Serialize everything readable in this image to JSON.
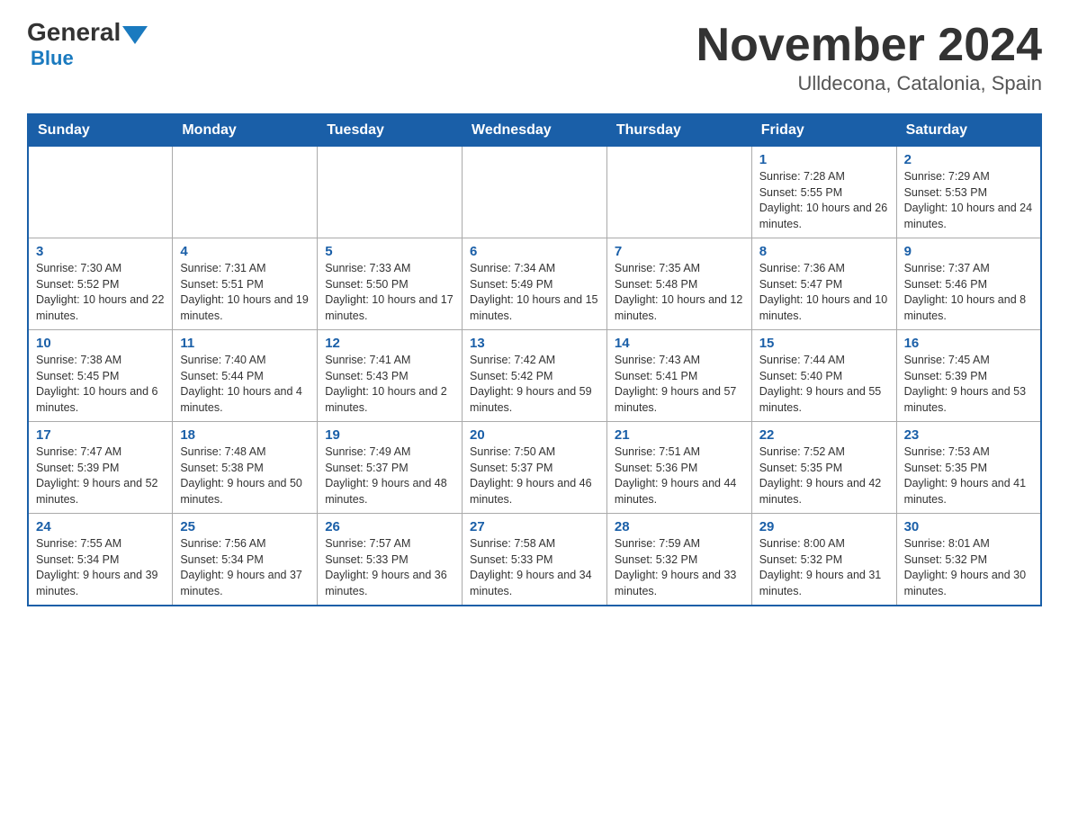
{
  "header": {
    "logo_general": "General",
    "logo_blue": "Blue",
    "month_title": "November 2024",
    "location": "Ulldecona, Catalonia, Spain"
  },
  "days_of_week": [
    "Sunday",
    "Monday",
    "Tuesday",
    "Wednesday",
    "Thursday",
    "Friday",
    "Saturday"
  ],
  "weeks": [
    [
      {
        "day": "",
        "info": ""
      },
      {
        "day": "",
        "info": ""
      },
      {
        "day": "",
        "info": ""
      },
      {
        "day": "",
        "info": ""
      },
      {
        "day": "",
        "info": ""
      },
      {
        "day": "1",
        "info": "Sunrise: 7:28 AM\nSunset: 5:55 PM\nDaylight: 10 hours and 26 minutes."
      },
      {
        "day": "2",
        "info": "Sunrise: 7:29 AM\nSunset: 5:53 PM\nDaylight: 10 hours and 24 minutes."
      }
    ],
    [
      {
        "day": "3",
        "info": "Sunrise: 7:30 AM\nSunset: 5:52 PM\nDaylight: 10 hours and 22 minutes."
      },
      {
        "day": "4",
        "info": "Sunrise: 7:31 AM\nSunset: 5:51 PM\nDaylight: 10 hours and 19 minutes."
      },
      {
        "day": "5",
        "info": "Sunrise: 7:33 AM\nSunset: 5:50 PM\nDaylight: 10 hours and 17 minutes."
      },
      {
        "day": "6",
        "info": "Sunrise: 7:34 AM\nSunset: 5:49 PM\nDaylight: 10 hours and 15 minutes."
      },
      {
        "day": "7",
        "info": "Sunrise: 7:35 AM\nSunset: 5:48 PM\nDaylight: 10 hours and 12 minutes."
      },
      {
        "day": "8",
        "info": "Sunrise: 7:36 AM\nSunset: 5:47 PM\nDaylight: 10 hours and 10 minutes."
      },
      {
        "day": "9",
        "info": "Sunrise: 7:37 AM\nSunset: 5:46 PM\nDaylight: 10 hours and 8 minutes."
      }
    ],
    [
      {
        "day": "10",
        "info": "Sunrise: 7:38 AM\nSunset: 5:45 PM\nDaylight: 10 hours and 6 minutes."
      },
      {
        "day": "11",
        "info": "Sunrise: 7:40 AM\nSunset: 5:44 PM\nDaylight: 10 hours and 4 minutes."
      },
      {
        "day": "12",
        "info": "Sunrise: 7:41 AM\nSunset: 5:43 PM\nDaylight: 10 hours and 2 minutes."
      },
      {
        "day": "13",
        "info": "Sunrise: 7:42 AM\nSunset: 5:42 PM\nDaylight: 9 hours and 59 minutes."
      },
      {
        "day": "14",
        "info": "Sunrise: 7:43 AM\nSunset: 5:41 PM\nDaylight: 9 hours and 57 minutes."
      },
      {
        "day": "15",
        "info": "Sunrise: 7:44 AM\nSunset: 5:40 PM\nDaylight: 9 hours and 55 minutes."
      },
      {
        "day": "16",
        "info": "Sunrise: 7:45 AM\nSunset: 5:39 PM\nDaylight: 9 hours and 53 minutes."
      }
    ],
    [
      {
        "day": "17",
        "info": "Sunrise: 7:47 AM\nSunset: 5:39 PM\nDaylight: 9 hours and 52 minutes."
      },
      {
        "day": "18",
        "info": "Sunrise: 7:48 AM\nSunset: 5:38 PM\nDaylight: 9 hours and 50 minutes."
      },
      {
        "day": "19",
        "info": "Sunrise: 7:49 AM\nSunset: 5:37 PM\nDaylight: 9 hours and 48 minutes."
      },
      {
        "day": "20",
        "info": "Sunrise: 7:50 AM\nSunset: 5:37 PM\nDaylight: 9 hours and 46 minutes."
      },
      {
        "day": "21",
        "info": "Sunrise: 7:51 AM\nSunset: 5:36 PM\nDaylight: 9 hours and 44 minutes."
      },
      {
        "day": "22",
        "info": "Sunrise: 7:52 AM\nSunset: 5:35 PM\nDaylight: 9 hours and 42 minutes."
      },
      {
        "day": "23",
        "info": "Sunrise: 7:53 AM\nSunset: 5:35 PM\nDaylight: 9 hours and 41 minutes."
      }
    ],
    [
      {
        "day": "24",
        "info": "Sunrise: 7:55 AM\nSunset: 5:34 PM\nDaylight: 9 hours and 39 minutes."
      },
      {
        "day": "25",
        "info": "Sunrise: 7:56 AM\nSunset: 5:34 PM\nDaylight: 9 hours and 37 minutes."
      },
      {
        "day": "26",
        "info": "Sunrise: 7:57 AM\nSunset: 5:33 PM\nDaylight: 9 hours and 36 minutes."
      },
      {
        "day": "27",
        "info": "Sunrise: 7:58 AM\nSunset: 5:33 PM\nDaylight: 9 hours and 34 minutes."
      },
      {
        "day": "28",
        "info": "Sunrise: 7:59 AM\nSunset: 5:32 PM\nDaylight: 9 hours and 33 minutes."
      },
      {
        "day": "29",
        "info": "Sunrise: 8:00 AM\nSunset: 5:32 PM\nDaylight: 9 hours and 31 minutes."
      },
      {
        "day": "30",
        "info": "Sunrise: 8:01 AM\nSunset: 5:32 PM\nDaylight: 9 hours and 30 minutes."
      }
    ]
  ]
}
